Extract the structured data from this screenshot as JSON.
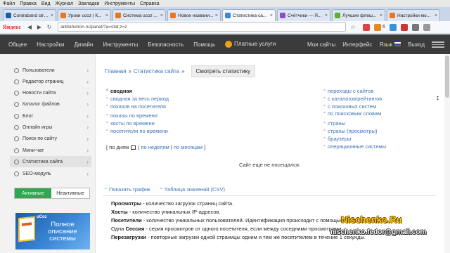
{
  "browser": {
    "menu": [
      "Файл",
      "Правка",
      "Вид",
      "Журнал",
      "Закладки",
      "Инструменты",
      "Справка"
    ],
    "tabs": [
      {
        "label": "Contraband stream...",
        "color": "#1b5fb0"
      },
      {
        "label": "Уроки ucoz | К...",
        "color": "#e87722"
      },
      {
        "label": "Система ucoz ...",
        "color": "#e87722"
      },
      {
        "label": "Новое названи...",
        "color": "#e87722"
      },
      {
        "label": "Статистика са...",
        "color": "#3a86d6"
      },
      {
        "label": "Счётчики — Я...",
        "color": "#8a4fd0"
      },
      {
        "label": "Лучшие флеш...",
        "color": "#5bb030"
      },
      {
        "label": "Настройки мо...",
        "color": "#e87722"
      }
    ],
    "brand": "Яндекс",
    "url": "antilohotron.ru/panel/?a=stat;z=z",
    "extension_badge": "6"
  },
  "site_nav": {
    "items": [
      "Общее",
      "Настройки",
      "Дизайн",
      "Инструменты",
      "Безопасность",
      "Помощь"
    ],
    "paid": "Платные услуги",
    "right": [
      "Мои сайты",
      "Интерфейс",
      "Язык",
      "Выход"
    ]
  },
  "sidebar": {
    "items": [
      {
        "label": "Пользователи"
      },
      {
        "label": "Редактор страниц"
      },
      {
        "label": "Новости сайта"
      },
      {
        "label": "Каталог файлов"
      },
      {
        "label": "Блог"
      },
      {
        "label": "Онлайн игры"
      },
      {
        "label": "Поиск по сайту"
      },
      {
        "label": "Мини-чат"
      },
      {
        "label": "Статистика сайта"
      },
      {
        "label": "SEO-модуль"
      }
    ],
    "toggle_active": "Активные",
    "toggle_inactive": "Неактивные",
    "ad_brand": "uCoz",
    "ad_text": "Полное описание системы"
  },
  "breadcrumb": {
    "home": "Главная",
    "section": "Статистика сайта",
    "current": "Смотреть статистику"
  },
  "stats_left": [
    "сводная",
    "сводная за весь период",
    "показов на посетителя",
    "показы по времени",
    "хосты по времени",
    "посетители по времени"
  ],
  "stats_right": [
    "переходы с сайтов",
    "с каталогов/рейтингов",
    "с поисковых систем",
    "по поисковым словам",
    "страны",
    "страны (просмотры)",
    "браузеры",
    "операционные системы"
  ],
  "filters": {
    "by_days": "по дням",
    "by_weeks": "по неделям",
    "by_months": "по месяцам"
  },
  "empty_message": "Сайт еще не посещался.",
  "tools": {
    "graph": "Показать график",
    "table": "Таблица значений (CSV)"
  },
  "definitions": [
    {
      "term": "Просмотры",
      "text": " - количество загрузок страниц сайта."
    },
    {
      "term": "Хосты",
      "text": " - количество уникальных IP-адресов."
    },
    {
      "term": "Посетители",
      "text": " - количество уникальных пользователей. Идентификация происходит с помощью"
    },
    {
      "term": "Сессия",
      "prefix": "Одна ",
      "text": " - серия просмотров от одного посетителя, если между соседними просмотрами"
    },
    {
      "term": "Перезагрузки",
      "text": " - повторные загрузки одной страницы одним и тем же посетителем в течение 1 секунды."
    }
  ],
  "watermark": {
    "site": "Nischenko.Ru",
    "email": "nischenko.fedor@gmail.com"
  }
}
